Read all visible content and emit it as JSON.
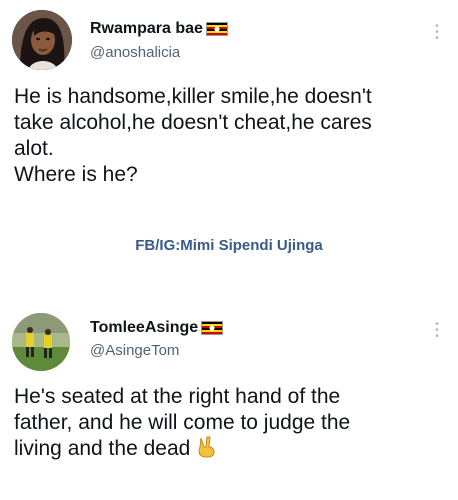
{
  "tweets": [
    {
      "display_name": "Rwampara bae",
      "handle": "@anoshalicia",
      "text_lines": [
        "He is handsome,killer smile,he doesn't",
        "take alcohol,he doesn't cheat,he cares",
        "alot.",
        "Where is he?"
      ],
      "avatar_icon": "woman-portrait-avatar",
      "flag_icon": "uganda-flag-icon"
    },
    {
      "display_name": "TomleeAsinge",
      "handle": "@AsingeTom",
      "text_lines": [
        "He's seated at the right hand of the",
        "father, and he will come to judge the",
        "living and the dead"
      ],
      "avatar_icon": "football-players-avatar",
      "flag_icon": "uganda-flag-icon",
      "emoji_icon": "victory-hand-emoji"
    }
  ],
  "watermark": "FB/IG:Mimi Sipendi Ujinga",
  "colors": {
    "text": "#0f1419",
    "secondary": "#536471",
    "watermark": "#3a5a8a",
    "flag_black": "#000000",
    "flag_yellow": "#fcdc04",
    "flag_red": "#d90000"
  }
}
